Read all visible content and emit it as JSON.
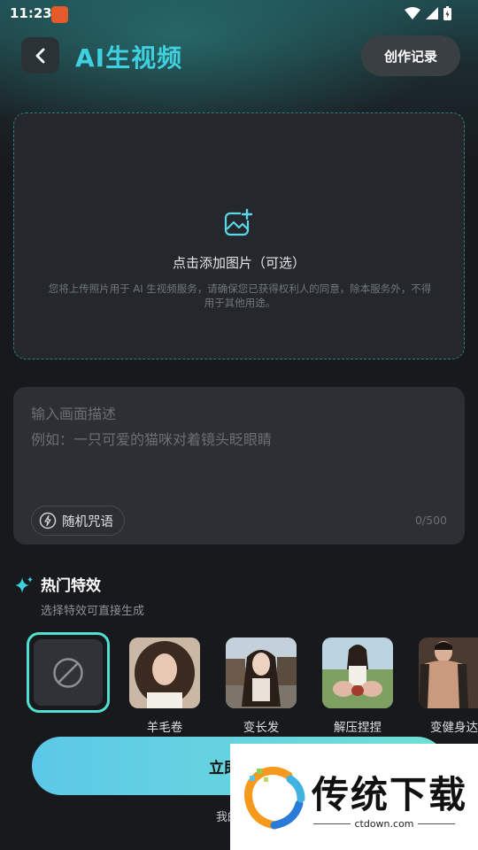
{
  "status_bar": {
    "time": "11:23"
  },
  "header": {
    "title": "AI生视频",
    "history_label": "创作记录"
  },
  "upload": {
    "title": "点击添加图片（可选）",
    "notice": "您将上传照片用于 AI 生视频服务，请确保您已获得权利人的同意，除本服务外，不得用于其他用途。"
  },
  "prompt": {
    "placeholder_line1": "输入画面描述",
    "placeholder_line2": "例如：一只可爱的猫咪对着镜头眨眼睛",
    "random_label": "随机咒语",
    "char_count": "0/500"
  },
  "hot": {
    "title": "热门特效",
    "subtitle": "选择特效可直接生成",
    "effects": [
      {
        "label": "羊毛卷"
      },
      {
        "label": "变长发"
      },
      {
        "label": "解压捏捏"
      },
      {
        "label": "变健身达"
      }
    ]
  },
  "generate": {
    "label": "立即生成"
  },
  "coins": {
    "text": "我的金币"
  },
  "watermark": {
    "name": "传统下载",
    "url": "ctdown.com"
  },
  "colors": {
    "accent": "#3fd0e0",
    "selected_border": "#4fe0cf",
    "button_start": "#5cc8e8",
    "button_end": "#6fe0d4"
  }
}
